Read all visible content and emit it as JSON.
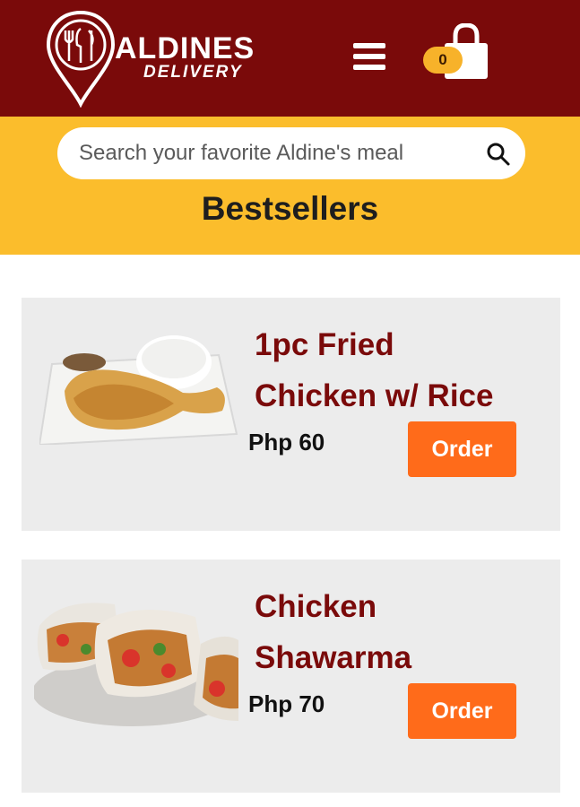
{
  "header": {
    "brand_name": "ALDINES",
    "brand_sub": "DELIVERY",
    "cart_count": "0",
    "background": "#7a0a0a"
  },
  "search": {
    "placeholder": "Search your favorite Aldine's meal"
  },
  "section": {
    "title": "Bestsellers",
    "background": "#fbbd2c"
  },
  "products": [
    {
      "name_line1": "1pc Fried",
      "name_line2": "Chicken w/ Rice",
      "price": "Php 60",
      "order_label": "Order"
    },
    {
      "name_line1": "Chicken",
      "name_line2": "Shawarma",
      "price": "Php 70",
      "order_label": "Order"
    }
  ],
  "colors": {
    "accent": "#ff6b1a",
    "card_bg": "#ececec",
    "title_text": "#7a0a0a"
  },
  "icons": [
    "logo-pin-icon",
    "menu-icon",
    "cart-bag-icon",
    "search-icon"
  ]
}
